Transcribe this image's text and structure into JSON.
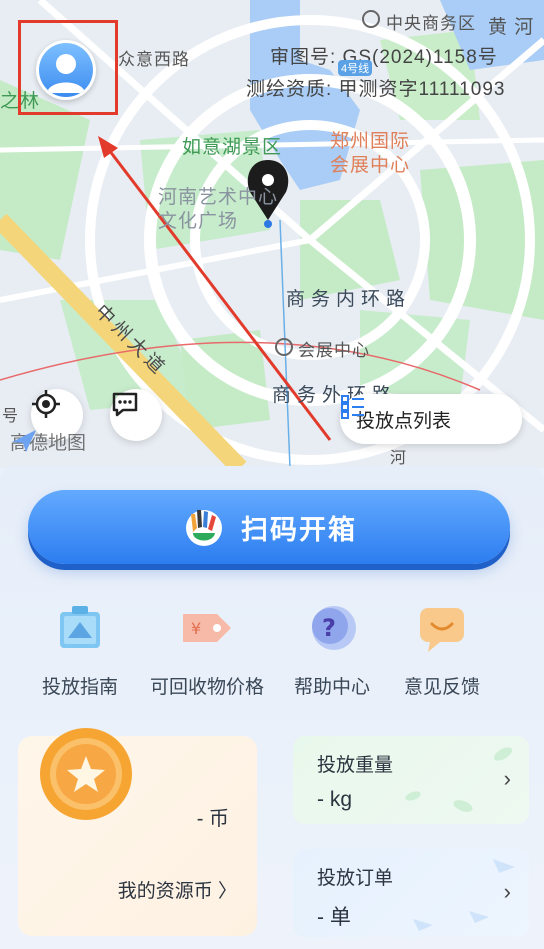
{
  "map": {
    "approval_no": "审图号:  GS(2024)1158号",
    "survey_qual": "测绘资质:  甲测资字11111093",
    "labels": {
      "zhongyang": "中央商务区",
      "huanghe": "黄 河",
      "zhongyi": "众意西路",
      "linzhi": "之林",
      "ruyi": "如意湖景区",
      "zhengzhou": "郑州国际\n会展中心",
      "henan": "河南艺术中心\n文化广场",
      "inner_ring": "商务内环路",
      "huizhan": "会展中心",
      "outer_ring": "商务外环路",
      "zhongzhou": "中州大道",
      "hao": "号",
      "he": "河",
      "line_badge": "4号线",
      "amap": "高德地图"
    }
  },
  "drop_point_list_label": "投放点列表",
  "scan_button_label": "扫码开箱",
  "features": [
    {
      "label": "投放指南",
      "icon": "guide-icon"
    },
    {
      "label": "可回收物价格",
      "icon": "price-tag-icon"
    },
    {
      "label": "帮助中心",
      "icon": "help-icon"
    },
    {
      "label": "意见反馈",
      "icon": "feedback-icon"
    }
  ],
  "coins": {
    "value": "- 币",
    "link_label": "我的资源币 〉"
  },
  "weight": {
    "title": "投放重量",
    "value": "- kg"
  },
  "orders": {
    "title": "投放订单",
    "value": "- 单"
  },
  "colors": {
    "primary": "#2c7df0",
    "highlight": "#e23a2b",
    "route": "#e23a2b"
  }
}
